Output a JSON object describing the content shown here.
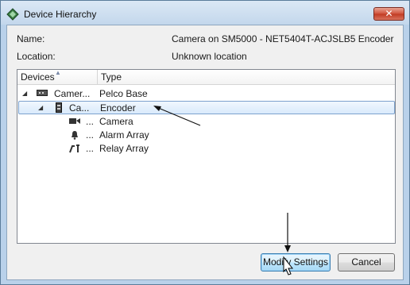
{
  "window": {
    "title": "Device Hierarchy",
    "close_label": "✕"
  },
  "fields": {
    "name_label": "Name:",
    "name_value": "Camera on SM5000 - NET5404T-ACJSLB5 Encoder",
    "location_label": "Location:",
    "location_value": "Unknown location"
  },
  "tree": {
    "columns": {
      "devices": "Devices",
      "type": "Type"
    },
    "rows": [
      {
        "name": "Camer...",
        "type": "Pelco Base",
        "expanded": true,
        "icon": "rack-device-icon"
      },
      {
        "name": "Ca...",
        "type": "Encoder",
        "expanded": true,
        "selected": true,
        "icon": "encoder-icon"
      },
      {
        "name": "...",
        "type": "Camera",
        "icon": "camera-icon"
      },
      {
        "name": "...",
        "type": "Alarm Array",
        "icon": "bell-icon"
      },
      {
        "name": "...",
        "type": "Relay Array",
        "icon": "relay-icon"
      }
    ]
  },
  "buttons": {
    "modify": "Modify Settings",
    "cancel": "Cancel"
  },
  "colors": {
    "selection_border": "#7da2ce",
    "close_button": "#c03a22",
    "frame": "#b9d1ea"
  }
}
